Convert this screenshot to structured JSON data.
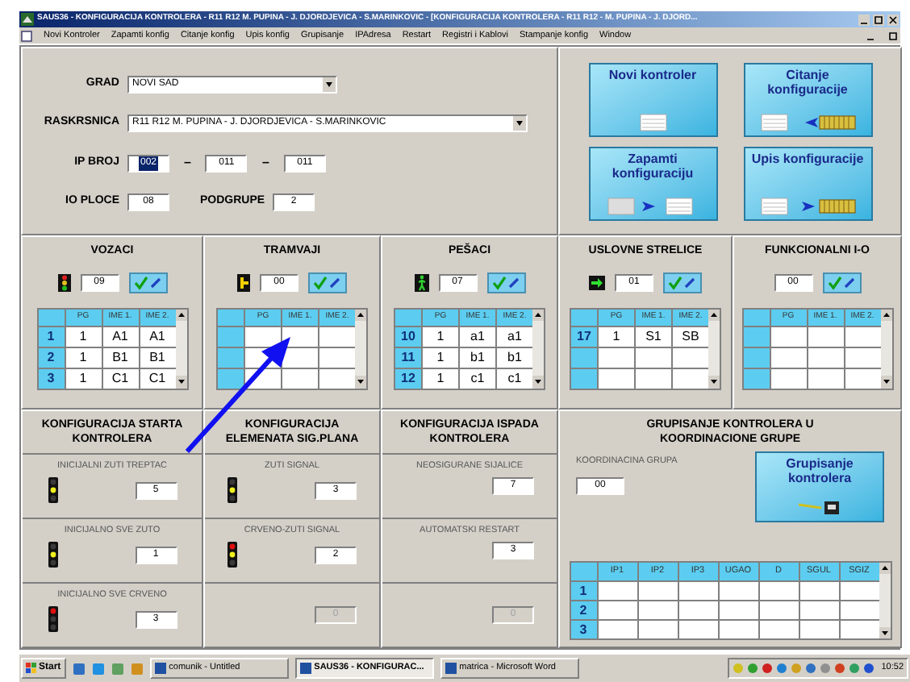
{
  "window": {
    "title": "SAUS36 - KONFIGURACIJA KONTROLERA - R11 R12  M. PUPINA - J. DJORDJEVICA - S.MARINKOVIC - [KONFIGURACIJA KONTROLERA - R11 R12 - M. PUPINA - J. DJORD..."
  },
  "menu": [
    "Novi Kontroler",
    "Zapamti konfig",
    "Citanje konfig",
    "Upis konfig",
    "Grupisanje",
    "IPAdresa",
    "Restart",
    "Registri i Kablovi",
    "Stampanje konfig",
    "Window"
  ],
  "form": {
    "grad": {
      "label": "GRAD",
      "value": "NOVI SAD"
    },
    "raskrsnica": {
      "label": "RASKRSNICA",
      "value": "R11 R12  M. PUPINA - J. DJORDJEVICA - S.MARINKOVIC"
    },
    "ip_broj": {
      "label": "IP BROJ",
      "separators": [
        "–",
        "–"
      ],
      "parts": [
        {
          "value": "002",
          "highlighted": true
        },
        {
          "value": "011",
          "highlighted": false
        },
        {
          "value": "011",
          "highlighted": false
        }
      ]
    },
    "io_ploce": {
      "label": "IO PLOCE",
      "value": "08"
    },
    "podgrupe": {
      "label": "PODGRUPE",
      "value": "2"
    }
  },
  "action_buttons": [
    {
      "label": "Novi kontroler",
      "kind": "new"
    },
    {
      "label": "Citanje konfiguracije",
      "kind": "read"
    },
    {
      "label": "Zapamti konfiguraciju",
      "kind": "save"
    },
    {
      "label": "Upis konfiguracije",
      "kind": "write"
    }
  ],
  "signal_panels": [
    {
      "title": "VOZACI",
      "kind": "vehicle",
      "count": "09",
      "columns": [
        "PG",
        "IME 1.",
        "IME 2."
      ],
      "rows": [
        {
          "index": "1",
          "cells": [
            "1",
            "A1",
            "A1"
          ]
        },
        {
          "index": "2",
          "cells": [
            "1",
            "B1",
            "B1"
          ]
        },
        {
          "index": "3",
          "cells": [
            "1",
            "C1",
            "C1"
          ]
        }
      ]
    },
    {
      "title": "TRAMVAJI",
      "kind": "tram",
      "count": "00",
      "columns": [
        "PG",
        "IME 1.",
        "IME 2."
      ]
    },
    {
      "title": "PEŠACI",
      "kind": "pedestrian",
      "count": "07",
      "columns": [
        "PG",
        "IME 1.",
        "IME 2."
      ],
      "rows": [
        {
          "index": "10",
          "cells": [
            "1",
            "a1",
            "a1"
          ]
        },
        {
          "index": "11",
          "cells": [
            "1",
            "b1",
            "b1"
          ]
        },
        {
          "index": "12",
          "cells": [
            "1",
            "c1",
            "c1"
          ]
        }
      ]
    },
    {
      "title": "USLOVNE STRELICE",
      "kind": "arrow",
      "count": "01",
      "columns": [
        "PG",
        "IME 1.",
        "IME 2."
      ],
      "rows": [
        {
          "index": "17",
          "cells": [
            "1",
            "S1",
            "SB"
          ]
        }
      ]
    },
    {
      "title": "FUNKCIONALNI I-O",
      "kind": "none",
      "count": "00",
      "columns": [
        "PG",
        "IME 1.",
        "IME 2."
      ]
    }
  ],
  "config_sections": [
    {
      "title": "KONFIGURACIJA STARTA KONTROLERA",
      "fields": [
        {
          "label": "INICIJALNI ZUTI TREPTAC",
          "kind": "yellow",
          "value": "5",
          "disabled": false
        },
        {
          "label": "INICIJALNO SVE ZUTO",
          "kind": "yellow",
          "value": "1",
          "disabled": false
        },
        {
          "label": "INICIJALNO SVE CRVENO",
          "kind": "red",
          "value": "3",
          "disabled": false
        }
      ]
    },
    {
      "title": "KONFIGURACIJA ELEMENATA SIG.PLANA",
      "fields": [
        {
          "label": "ZUTI SIGNAL",
          "kind": "yellow",
          "value": "3",
          "disabled": false
        },
        {
          "label": "CRVENO-ZUTI SIGNAL",
          "kind": "redyellow",
          "value": "2",
          "disabled": false
        },
        {
          "kind": "none",
          "value": "0",
          "disabled": true
        }
      ]
    },
    {
      "title": "KONFIGURACIJA ISPADA KONTROLERA",
      "fields": [
        {
          "label": "NEOSIGURANE SIJALICE",
          "kind": "none",
          "value": "7",
          "disabled": false
        },
        {
          "label": "AUTOMATSKI RESTART",
          "kind": "none",
          "value": "3",
          "disabled": false
        },
        {
          "kind": "none",
          "value": "0",
          "disabled": true
        }
      ]
    }
  ],
  "grouping": {
    "title": "GRUPISANJE KONTROLERA U KOORDINACIONE GRUPE",
    "field_label": "KOORDINACINA GRUPA",
    "field_value": "00",
    "button": "Grupisanje kontrolera",
    "columns": [
      "IP1",
      "IP2",
      "IP3",
      "UGAO",
      "D",
      "SGUL",
      "SGIZ"
    ],
    "row_labels": [
      "1",
      "2",
      "3"
    ]
  },
  "taskbar": {
    "start": "Start",
    "tasks": [
      {
        "label": "comunik - Untitled",
        "selected": false
      },
      {
        "label": "SAUS36 - KONFIGURAC...",
        "selected": true
      },
      {
        "label": "matrica - Microsoft Word",
        "selected": false
      }
    ],
    "clock": "10:52"
  }
}
